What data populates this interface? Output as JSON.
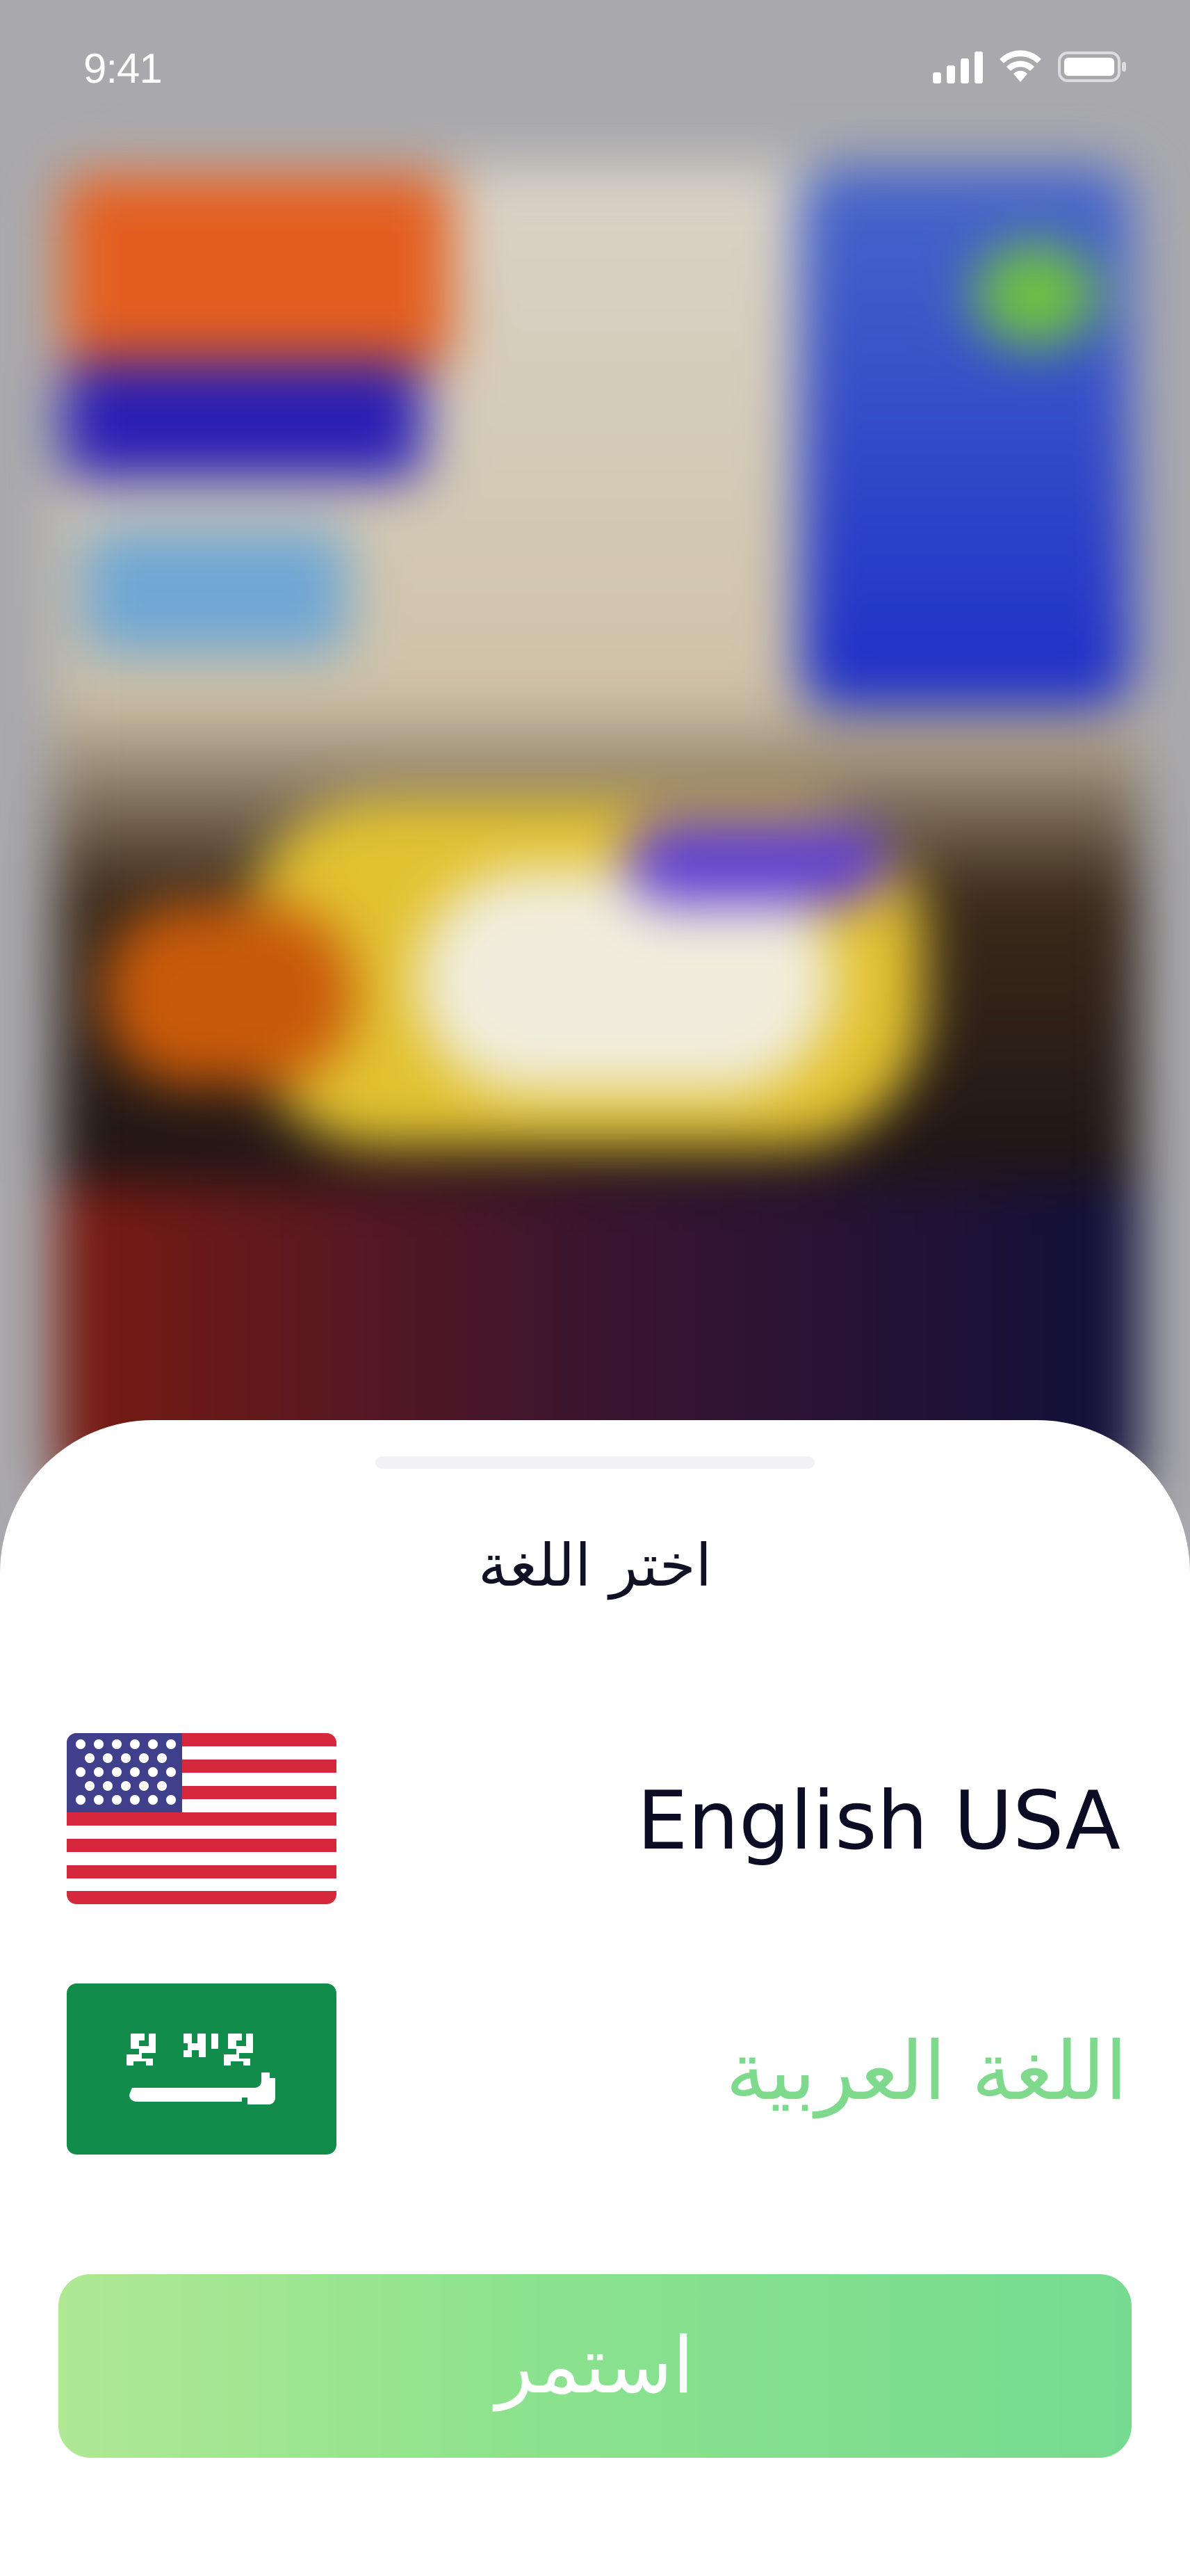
{
  "status_bar": {
    "time": "9:41",
    "icons": [
      "signal-icon",
      "wifi-icon",
      "battery-icon"
    ]
  },
  "sheet": {
    "title": "اختر اللغة",
    "languages": [
      {
        "label": "English USA",
        "flag_icon": "us-flag-icon",
        "state": "default",
        "text_color": "#0c0c24"
      },
      {
        "label": "اللغة العربية",
        "flag_icon": "saudi-flag-icon",
        "state": "selected",
        "text_color": "#7ed98c"
      }
    ],
    "continue_label": "استمر"
  },
  "colors": {
    "accent_start": "#b0e895",
    "accent_end": "#76db90",
    "title_text": "#111125",
    "saudi_green": "#128c4b"
  }
}
